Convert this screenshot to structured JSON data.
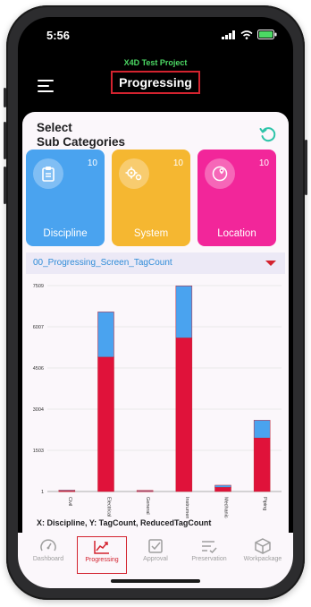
{
  "status_bar": {
    "time": "5:56"
  },
  "header": {
    "project": "X4D Test Project",
    "title": "Progressing"
  },
  "select": {
    "title_line1": "Select",
    "title_line2": "Sub Categories"
  },
  "cards": [
    {
      "label": "Discipline",
      "count": "10",
      "color": "#4aa3ef",
      "icon": "clipboard-icon"
    },
    {
      "label": "System",
      "count": "10",
      "color": "#f5b731",
      "icon": "gears-icon"
    },
    {
      "label": "Location",
      "count": "10",
      "color": "#f2269a",
      "icon": "map-pin-icon"
    }
  ],
  "dropdown": {
    "selected": "00_Progressing_Screen_TagCount"
  },
  "chart_data": {
    "type": "bar",
    "stacked": true,
    "categories": [
      "Civil",
      "Electrical",
      "General",
      "Instrumentation",
      "Mechanical",
      "Piping"
    ],
    "series": [
      {
        "values": [
          20,
          4900,
          20,
          5600,
          150,
          1950
        ],
        "color": "#e0123a"
      },
      {
        "values": [
          30,
          1650,
          20,
          1900,
          80,
          650
        ],
        "color": "#4aa3ef"
      }
    ],
    "yticks": [
      "7509",
      "6007",
      "4506",
      "3004",
      "1503",
      "1"
    ],
    "ylim": [
      1,
      7509
    ],
    "caption": "X: Discipline, Y: TagCount, ReducedTagCount"
  },
  "tabs": [
    {
      "label": "Dashboard",
      "icon": "gauge-icon"
    },
    {
      "label": "Progressing",
      "icon": "trend-chart-icon",
      "active": true
    },
    {
      "label": "Approval",
      "icon": "check-box-icon"
    },
    {
      "label": "Preservation",
      "icon": "list-check-icon"
    },
    {
      "label": "Workpackage",
      "icon": "package-icon"
    }
  ]
}
